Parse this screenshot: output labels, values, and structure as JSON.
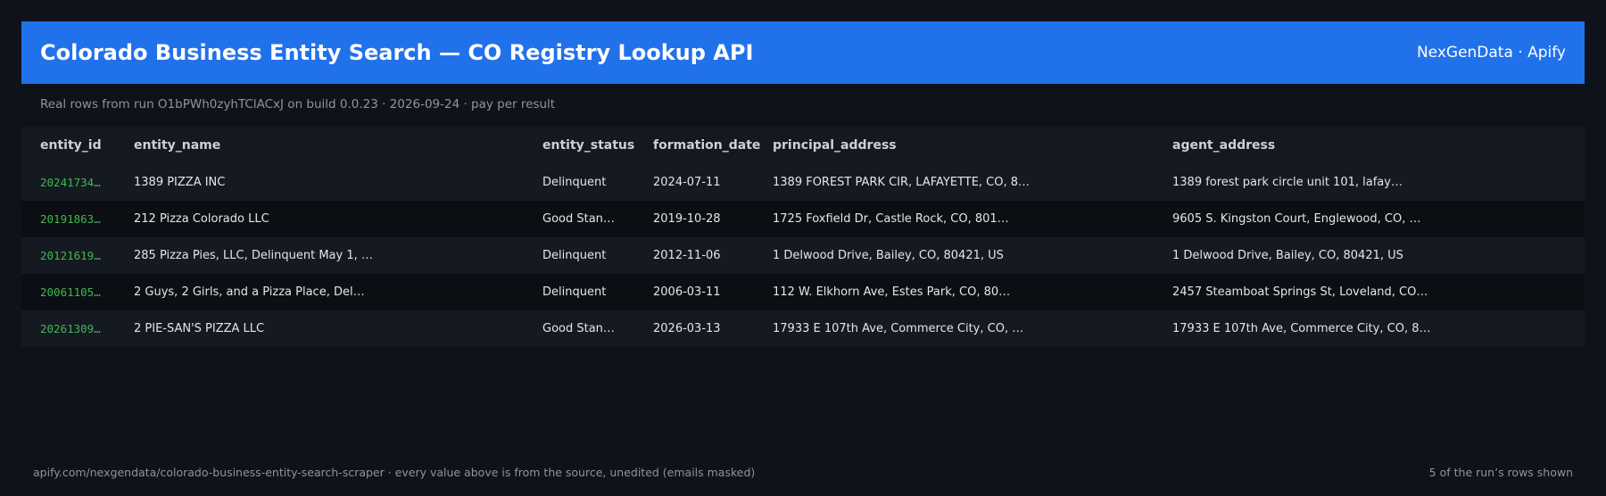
{
  "header": {
    "title": "Colorado Business Entity Search — CO Registry Lookup API",
    "brand": "NexGenData · Apify"
  },
  "subtitle": "Real rows from run O1bPWh0zyhTClACxJ on build 0.0.23 · 2026-09-24 · pay per result",
  "table": {
    "columns": [
      "entity_id",
      "entity_name",
      "entity_status",
      "formation_date",
      "principal_address",
      "agent_address"
    ],
    "rows": [
      [
        "20241734…",
        "1389 PIZZA INC",
        "Delinquent",
        "2024-07-11",
        "1389 FOREST PARK CIR, LAFAYETTE, CO, 8…",
        "1389 forest park circle unit 101, lafay…"
      ],
      [
        "20191863…",
        "212 Pizza Colorado LLC",
        "Good Stan…",
        "2019-10-28",
        "1725 Foxfield Dr, Castle Rock, CO, 801…",
        "9605 S. Kingston Court, Englewood, CO, …"
      ],
      [
        "20121619…",
        "285 Pizza Pies, LLC, Delinquent May 1, …",
        "Delinquent",
        "2012-11-06",
        "1 Delwood Drive, Bailey, CO, 80421, US",
        "1 Delwood Drive, Bailey, CO, 80421, US"
      ],
      [
        "20061105…",
        "2 Guys, 2 Girls, and a Pizza Place, Del…",
        "Delinquent",
        "2006-03-11",
        "112 W. Elkhorn Ave, Estes Park, CO, 80…",
        "2457 Steamboat Springs St, Loveland, CO…"
      ],
      [
        "20261309…",
        "2 PIE-SAN'S PIZZA LLC",
        "Good Stan…",
        "2026-03-13",
        "17933 E 107th Ave, Commerce City, CO, …",
        "17933 E 107th Ave, Commerce City, CO, 8…"
      ]
    ]
  },
  "footer": {
    "source": "apify.com/nexgendata/colorado-business-entity-search-scraper  ·  every value above is from the source, unedited (emails masked)",
    "count": "5 of the run’s rows shown"
  },
  "colors": {
    "header_bg": "#2171eb",
    "page_bg": "#0e121b",
    "id_text": "#3fb950"
  }
}
